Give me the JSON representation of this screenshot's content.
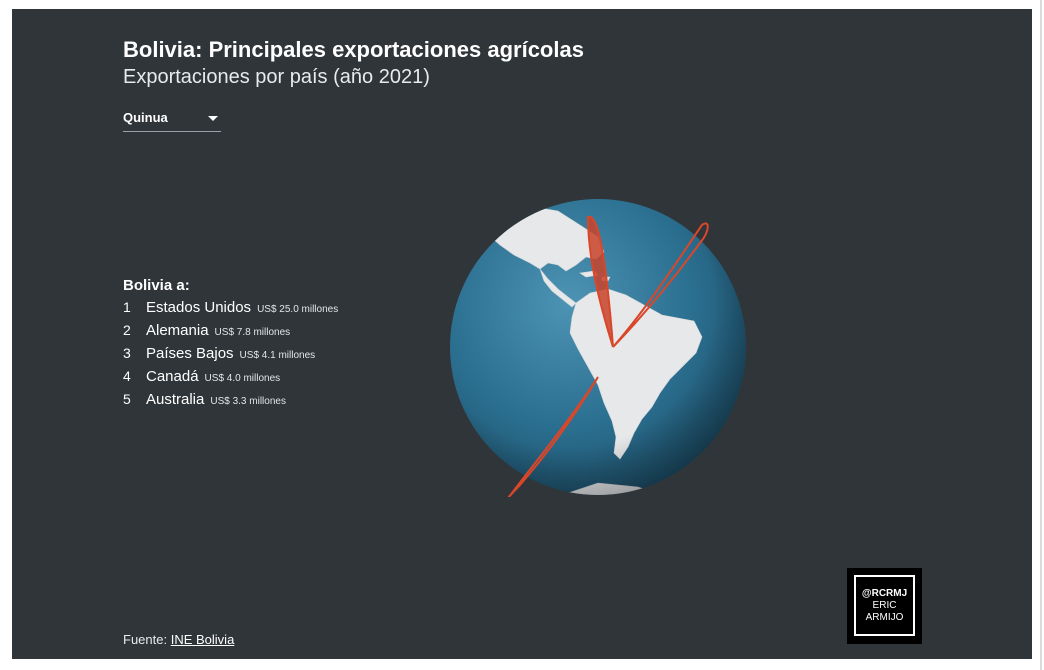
{
  "header": {
    "title": "Bolivia: Principales exportaciones agrícolas",
    "subtitle": "Exportaciones por país (año 2021)"
  },
  "product_select": {
    "selected": "Quinua"
  },
  "ranking": {
    "heading": "Bolivia a:",
    "items": [
      {
        "rank": "1",
        "country": "Estados Unidos",
        "value": "US$ 25.0 millones"
      },
      {
        "rank": "2",
        "country": "Alemania",
        "value": "US$ 7.8 millones"
      },
      {
        "rank": "3",
        "country": "Países Bajos",
        "value": "US$ 4.1 millones"
      },
      {
        "rank": "4",
        "country": "Canadá",
        "value": "US$ 4.0 millones"
      },
      {
        "rank": "5",
        "country": "Australia",
        "value": "US$ 3.3 millones"
      }
    ]
  },
  "map": {
    "origin": "Bolivia",
    "route_color": "#d9472b",
    "ocean_color": "#2b6f90",
    "land_color": "#e6e8ea"
  },
  "logo": {
    "line1": "@RCRMJ",
    "line2": "ERIC",
    "line3": "ARMIJO"
  },
  "footer": {
    "source_label": "Fuente:",
    "source_link": "INE Bolivia"
  }
}
